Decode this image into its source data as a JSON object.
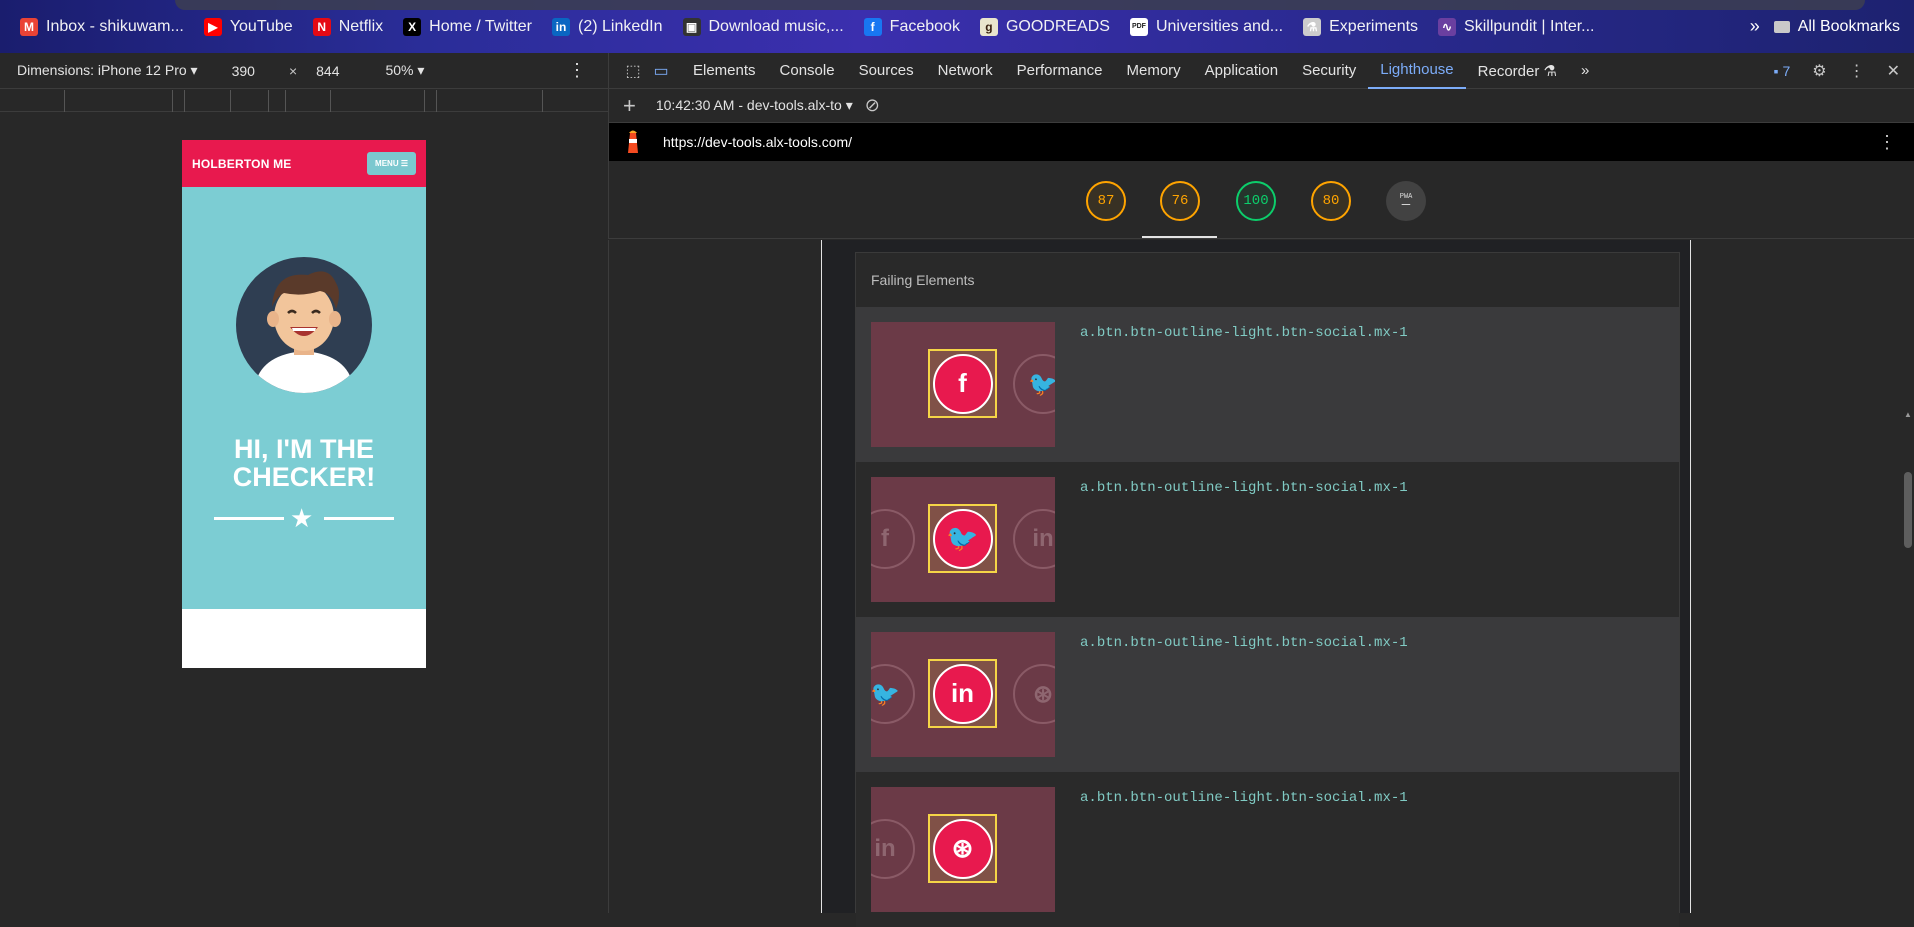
{
  "bookmarks": [
    {
      "label": "Inbox - shikuwam...",
      "icon": "gmail-icon",
      "color": "#ea4335",
      "glyph": "M"
    },
    {
      "label": "YouTube",
      "icon": "youtube-icon",
      "color": "#ff0000",
      "glyph": "▶"
    },
    {
      "label": "Netflix",
      "icon": "netflix-icon",
      "color": "#e50914",
      "glyph": "N"
    },
    {
      "label": "Home / Twitter",
      "icon": "x-icon",
      "color": "#000000",
      "glyph": "X"
    },
    {
      "label": "(2) LinkedIn",
      "icon": "linkedin-icon",
      "color": "#0a66c2",
      "glyph": "in"
    },
    {
      "label": "Download music,...",
      "icon": "download-icon",
      "color": "#333333",
      "glyph": "▣"
    },
    {
      "label": "Facebook",
      "icon": "facebook-icon",
      "color": "#1877f2",
      "glyph": "f"
    },
    {
      "label": "GOODREADS",
      "icon": "goodreads-icon",
      "color": "#e9e5cd",
      "glyph": "g"
    },
    {
      "label": "Universities and...",
      "icon": "pdf-icon",
      "color": "#ffffff",
      "glyph": "PDF"
    },
    {
      "label": "Experiments",
      "icon": "flask-icon",
      "color": "#cccccc",
      "glyph": "⚗"
    },
    {
      "label": "Skillpundit | Inter...",
      "icon": "skillpundit-icon",
      "color": "#6a3fa0",
      "glyph": "∿"
    }
  ],
  "bookmarks_more": "»",
  "all_bookmarks": "All Bookmarks",
  "device": {
    "dimensions_label": "Dimensions: iPhone 12 Pro",
    "width": "390",
    "times": "×",
    "height": "844",
    "zoom": "50%"
  },
  "site": {
    "brand": "HOLBERTON ME",
    "menu": "MENU ☰",
    "title": "HI, I'M THE CHECKER!"
  },
  "devtools": {
    "tabs": [
      "Elements",
      "Console",
      "Sources",
      "Network",
      "Performance",
      "Memory",
      "Application",
      "Security",
      "Lighthouse",
      "Recorder ⚗"
    ],
    "active_tab": "Lighthouse",
    "more": "»",
    "issues_count": "7",
    "report_time": "10:42:30 AM - dev-tools.alx-to",
    "url": "https://dev-tools.alx-tools.com/"
  },
  "scores": [
    {
      "value": "87",
      "status": "orange"
    },
    {
      "value": "76",
      "status": "orange"
    },
    {
      "value": "100",
      "status": "green"
    },
    {
      "value": "80",
      "status": "orange"
    },
    {
      "value": "PWA",
      "status": "gray"
    }
  ],
  "failing": {
    "heading": "Failing Elements",
    "rows": [
      {
        "selector": "a.btn.btn-outline-light.btn-social.mx-1",
        "focus_glyph": "f",
        "left_glyph": "",
        "right_glyph": "🐦"
      },
      {
        "selector": "a.btn.btn-outline-light.btn-social.mx-1",
        "focus_glyph": "🐦",
        "left_glyph": "f",
        "right_glyph": "in"
      },
      {
        "selector": "a.btn.btn-outline-light.btn-social.mx-1",
        "focus_glyph": "in",
        "left_glyph": "🐦",
        "right_glyph": "⊛"
      },
      {
        "selector": "a.btn.btn-outline-light.btn-social.mx-1",
        "focus_glyph": "⊛",
        "left_glyph": "in",
        "right_glyph": ""
      }
    ]
  }
}
